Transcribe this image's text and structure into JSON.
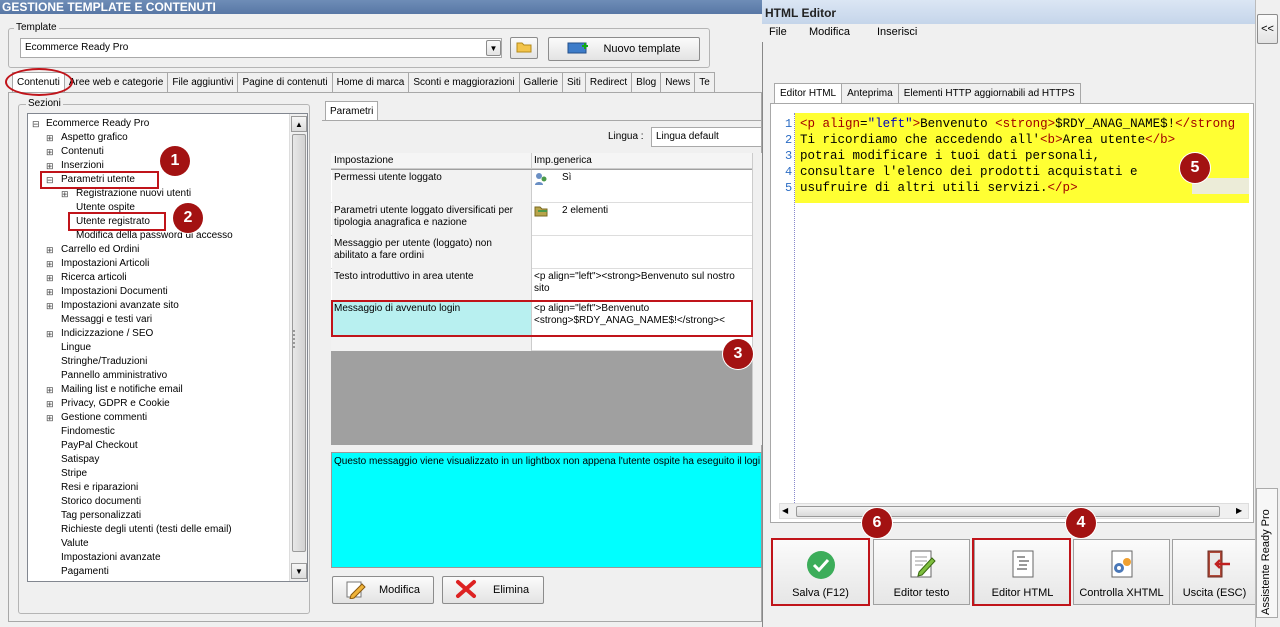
{
  "window": {
    "title": "GESTIONE TEMPLATE E CONTENUTI"
  },
  "template": {
    "group_label": "Template",
    "selected": "Ecommerce Ready Pro",
    "new_button": "Nuovo template"
  },
  "tabs": [
    "Contenuti",
    "Aree web e categorie",
    "File aggiuntivi",
    "Pagine di contenuti",
    "Home di marca",
    "Sconti e maggiorazioni",
    "Gallerie",
    "Siti",
    "Redirect",
    "Blog",
    "News",
    "Te"
  ],
  "sections": {
    "group_label": "Sezioni",
    "root": "Ecommerce Ready Pro",
    "items": [
      {
        "label": "Aspetto grafico",
        "expander": "+"
      },
      {
        "label": "Contenuti",
        "expander": "+"
      },
      {
        "label": "Inserzioni",
        "expander": "+"
      },
      {
        "label": "Parametri utente",
        "expander": "-"
      },
      {
        "label": "Registrazione nuovi utenti",
        "expander": "+"
      },
      {
        "label": "Utente ospite",
        "expander": ""
      },
      {
        "label": "Utente registrato",
        "expander": ""
      },
      {
        "label": "Modifica della password di accesso",
        "expander": ""
      },
      {
        "label": "Carrello ed Ordini",
        "expander": "+"
      },
      {
        "label": "Impostazioni Articoli",
        "expander": "+"
      },
      {
        "label": "Ricerca articoli",
        "expander": "+"
      },
      {
        "label": "Impostazioni Documenti",
        "expander": "+"
      },
      {
        "label": "Impostazioni avanzate sito",
        "expander": "+"
      },
      {
        "label": "Messaggi e testi vari",
        "expander": ""
      },
      {
        "label": "Indicizzazione / SEO",
        "expander": "+"
      },
      {
        "label": "Lingue",
        "expander": ""
      },
      {
        "label": "Stringhe/Traduzioni",
        "expander": ""
      },
      {
        "label": "Pannello amministrativo",
        "expander": ""
      },
      {
        "label": "Mailing list e notifiche email",
        "expander": "+"
      },
      {
        "label": "Privacy, GDPR e Cookie",
        "expander": "+"
      },
      {
        "label": "Gestione commenti",
        "expander": "+"
      },
      {
        "label": "Findomestic",
        "expander": ""
      },
      {
        "label": "PayPal Checkout",
        "expander": ""
      },
      {
        "label": "Satispay",
        "expander": ""
      },
      {
        "label": "Stripe",
        "expander": ""
      },
      {
        "label": "Resi e riparazioni",
        "expander": ""
      },
      {
        "label": "Storico documenti",
        "expander": ""
      },
      {
        "label": "Tag personalizzati",
        "expander": ""
      },
      {
        "label": "Richieste degli utenti (testi delle email)",
        "expander": ""
      },
      {
        "label": "Valute",
        "expander": ""
      },
      {
        "label": "Impostazioni avanzate",
        "expander": ""
      },
      {
        "label": "Pagamenti",
        "expander": ""
      }
    ]
  },
  "params": {
    "tab": "Parametri",
    "language_label": "Lingua :",
    "language_value": "Lingua default",
    "col_setting": "Impostazione",
    "col_value": "Imp.generica",
    "rows": [
      {
        "setting": "Permessi utente loggato",
        "value": "Sì"
      },
      {
        "setting": "Parametri utente loggato diversificati per tipologia anagrafica e nazione",
        "value": "2 elementi"
      },
      {
        "setting": "Messaggio per utente (loggato) non abilitato a fare ordini",
        "value": ""
      },
      {
        "setting": "Testo introduttivo in area utente",
        "value": "<p align=\"left\"><strong>Benvenuto sul nostro sito"
      },
      {
        "setting": "Messaggio di avvenuto login",
        "value": "<p align=\"left\">Benvenuto <strong>$RDY_ANAG_NAME$!</strong><"
      }
    ],
    "description": "Questo messaggio viene visualizzato in un lightbox non appena l'utente ospite ha eseguito il logi",
    "edit_button": "Modifica",
    "delete_button": "Elimina"
  },
  "editor": {
    "title": "HTML Editor",
    "menu": [
      "File",
      "Modifica",
      "Inserisci"
    ],
    "tabs": [
      "Editor HTML",
      "Anteprima",
      "Elementi HTTP aggiornabili ad HTTPS"
    ],
    "line_numbers": [
      "1",
      "2",
      "3",
      "4",
      "5"
    ],
    "lines": [
      "<p align=\"left\">Benvenuto <strong>$RDY_ANAG_NAME$!</strong",
      "Ti ricordiamo che accedendo all'<b>Area utente</b>",
      "potrai modificare i tuoi dati personali,",
      "consultare l'elenco dei prodotti acquistati e",
      "usufruire di altri utili servizi.</p>"
    ],
    "buttons": [
      "Salva (F12)",
      "Editor testo",
      "Editor HTML",
      "Controlla XHTML",
      "Uscita (ESC)"
    ]
  },
  "assistant": {
    "collapse": "<<",
    "label": "Assistente Ready Pro"
  },
  "badges": [
    "1",
    "2",
    "3",
    "4",
    "5",
    "6"
  ],
  "colors": {
    "accent_red": "#c0141a",
    "badge": "#a31212",
    "highlight_yellow": "#ffff33",
    "cyan": "#00ffff"
  }
}
